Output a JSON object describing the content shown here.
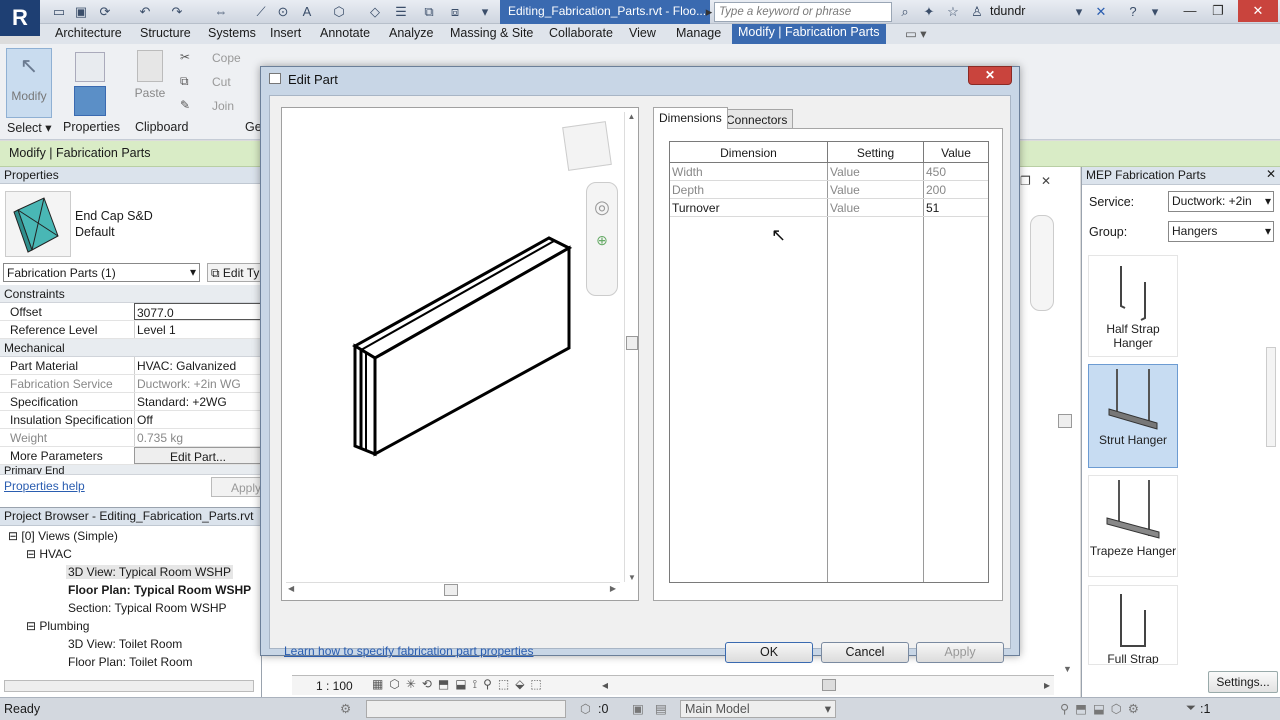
{
  "app": {
    "logo": "R",
    "doc_title": "Editing_Fabrication_Parts.rvt - Floo...",
    "search_placeholder": "Type a keyword or phrase",
    "user": "tdundr"
  },
  "ribbon": {
    "tabs": [
      "Architecture",
      "Structure",
      "Systems",
      "Insert",
      "Annotate",
      "Analyze",
      "Massing & Site",
      "Collaborate",
      "View",
      "Manage"
    ],
    "active_tab": "Modify | Fabrication Parts",
    "modify_label": "Modify",
    "paste_label": "Paste",
    "cope_label": "Cope",
    "cut_label": "Cut",
    "join_label": "Join",
    "groups": {
      "select": "Select",
      "properties": "Properties",
      "clipboard": "Clipboard",
      "geometry": "Ge"
    }
  },
  "context_bar": "Modify | Fabrication Parts",
  "properties": {
    "header": "Properties",
    "type_name": "End Cap S&D",
    "type_sub": "Default",
    "selector": "Fabrication Parts (1)",
    "edit_type": "Edit Ty",
    "sections": {
      "constraints": "Constraints",
      "mechanical": "Mechanical",
      "primary_end": "Primary End"
    },
    "rows": {
      "offset": {
        "k": "Offset",
        "v": "3077.0"
      },
      "ref_level": {
        "k": "Reference Level",
        "v": "Level 1"
      },
      "material": {
        "k": "Part Material",
        "v": "HVAC: Galvanized"
      },
      "service": {
        "k": "Fabrication Service",
        "v": "Ductwork: +2in WG"
      },
      "spec": {
        "k": "Specification",
        "v": "Standard: +2WG"
      },
      "insulation": {
        "k": "Insulation Specification",
        "v": "Off"
      },
      "weight": {
        "k": "Weight",
        "v": "0.735 kg"
      },
      "more": {
        "k": "More Parameters",
        "v": "Edit Part..."
      }
    },
    "help": "Properties help",
    "apply": "Apply"
  },
  "browser": {
    "header": "Project Browser - Editing_Fabrication_Parts.rvt",
    "views": "Views (Simple)",
    "hvac": "HVAC",
    "hvac_3d": "3D View: Typical Room WSHP",
    "hvac_floor": "Floor Plan: Typical Room WSHP",
    "hvac_section": "Section: Typical Room WSHP",
    "plumbing": "Plumbing",
    "plumb_3d": "3D View: Toilet Room",
    "plumb_floor": "Floor Plan: Toilet Room"
  },
  "mep": {
    "header": "MEP Fabrication Parts",
    "service_label": "Service:",
    "service_value": "Ductwork: +2in",
    "group_label": "Group:",
    "group_value": "Hangers",
    "items": [
      "Half Strap Hanger",
      "Strut Hanger",
      "Trapeze Hanger",
      "Full Strap"
    ],
    "settings": "Settings..."
  },
  "view_scale": "1 : 100",
  "status": {
    "ready": "Ready",
    "count": ":0",
    "model": "Main Model",
    "filter": ":1"
  },
  "dialog": {
    "title": "Edit Part",
    "tabs": [
      "Dimensions",
      "Connectors"
    ],
    "table": {
      "headers": [
        "Dimension",
        "Setting",
        "Value"
      ],
      "rows": [
        {
          "dimension": "Width",
          "setting": "Value",
          "value": "450"
        },
        {
          "dimension": "Depth",
          "setting": "Value",
          "value": "200"
        },
        {
          "dimension": "Turnover",
          "setting": "Value",
          "value": "51"
        }
      ]
    },
    "link": "Learn how to specify fabrication part properties",
    "ok": "OK",
    "cancel": "Cancel",
    "apply": "Apply"
  }
}
